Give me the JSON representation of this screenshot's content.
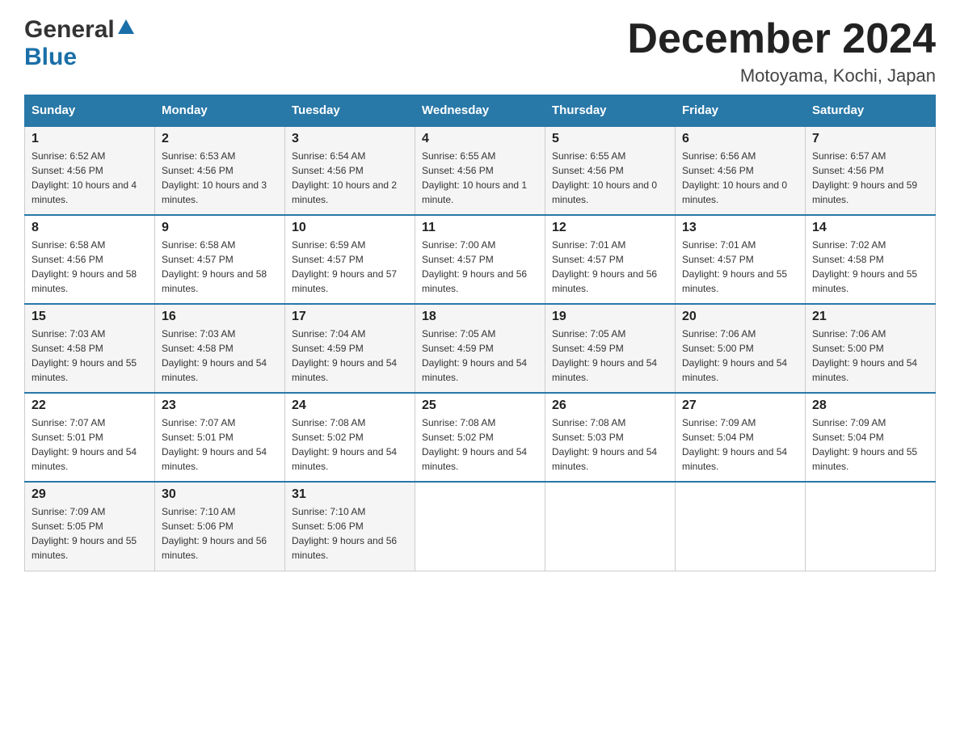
{
  "logo": {
    "general": "General",
    "blue": "Blue"
  },
  "title": {
    "month_year": "December 2024",
    "location": "Motoyama, Kochi, Japan"
  },
  "days_of_week": [
    "Sunday",
    "Monday",
    "Tuesday",
    "Wednesday",
    "Thursday",
    "Friday",
    "Saturday"
  ],
  "weeks": [
    [
      {
        "day": "1",
        "sunrise": "6:52 AM",
        "sunset": "4:56 PM",
        "daylight": "10 hours and 4 minutes."
      },
      {
        "day": "2",
        "sunrise": "6:53 AM",
        "sunset": "4:56 PM",
        "daylight": "10 hours and 3 minutes."
      },
      {
        "day": "3",
        "sunrise": "6:54 AM",
        "sunset": "4:56 PM",
        "daylight": "10 hours and 2 minutes."
      },
      {
        "day": "4",
        "sunrise": "6:55 AM",
        "sunset": "4:56 PM",
        "daylight": "10 hours and 1 minute."
      },
      {
        "day": "5",
        "sunrise": "6:55 AM",
        "sunset": "4:56 PM",
        "daylight": "10 hours and 0 minutes."
      },
      {
        "day": "6",
        "sunrise": "6:56 AM",
        "sunset": "4:56 PM",
        "daylight": "10 hours and 0 minutes."
      },
      {
        "day": "7",
        "sunrise": "6:57 AM",
        "sunset": "4:56 PM",
        "daylight": "9 hours and 59 minutes."
      }
    ],
    [
      {
        "day": "8",
        "sunrise": "6:58 AM",
        "sunset": "4:56 PM",
        "daylight": "9 hours and 58 minutes."
      },
      {
        "day": "9",
        "sunrise": "6:58 AM",
        "sunset": "4:57 PM",
        "daylight": "9 hours and 58 minutes."
      },
      {
        "day": "10",
        "sunrise": "6:59 AM",
        "sunset": "4:57 PM",
        "daylight": "9 hours and 57 minutes."
      },
      {
        "day": "11",
        "sunrise": "7:00 AM",
        "sunset": "4:57 PM",
        "daylight": "9 hours and 56 minutes."
      },
      {
        "day": "12",
        "sunrise": "7:01 AM",
        "sunset": "4:57 PM",
        "daylight": "9 hours and 56 minutes."
      },
      {
        "day": "13",
        "sunrise": "7:01 AM",
        "sunset": "4:57 PM",
        "daylight": "9 hours and 55 minutes."
      },
      {
        "day": "14",
        "sunrise": "7:02 AM",
        "sunset": "4:58 PM",
        "daylight": "9 hours and 55 minutes."
      }
    ],
    [
      {
        "day": "15",
        "sunrise": "7:03 AM",
        "sunset": "4:58 PM",
        "daylight": "9 hours and 55 minutes."
      },
      {
        "day": "16",
        "sunrise": "7:03 AM",
        "sunset": "4:58 PM",
        "daylight": "9 hours and 54 minutes."
      },
      {
        "day": "17",
        "sunrise": "7:04 AM",
        "sunset": "4:59 PM",
        "daylight": "9 hours and 54 minutes."
      },
      {
        "day": "18",
        "sunrise": "7:05 AM",
        "sunset": "4:59 PM",
        "daylight": "9 hours and 54 minutes."
      },
      {
        "day": "19",
        "sunrise": "7:05 AM",
        "sunset": "4:59 PM",
        "daylight": "9 hours and 54 minutes."
      },
      {
        "day": "20",
        "sunrise": "7:06 AM",
        "sunset": "5:00 PM",
        "daylight": "9 hours and 54 minutes."
      },
      {
        "day": "21",
        "sunrise": "7:06 AM",
        "sunset": "5:00 PM",
        "daylight": "9 hours and 54 minutes."
      }
    ],
    [
      {
        "day": "22",
        "sunrise": "7:07 AM",
        "sunset": "5:01 PM",
        "daylight": "9 hours and 54 minutes."
      },
      {
        "day": "23",
        "sunrise": "7:07 AM",
        "sunset": "5:01 PM",
        "daylight": "9 hours and 54 minutes."
      },
      {
        "day": "24",
        "sunrise": "7:08 AM",
        "sunset": "5:02 PM",
        "daylight": "9 hours and 54 minutes."
      },
      {
        "day": "25",
        "sunrise": "7:08 AM",
        "sunset": "5:02 PM",
        "daylight": "9 hours and 54 minutes."
      },
      {
        "day": "26",
        "sunrise": "7:08 AM",
        "sunset": "5:03 PM",
        "daylight": "9 hours and 54 minutes."
      },
      {
        "day": "27",
        "sunrise": "7:09 AM",
        "sunset": "5:04 PM",
        "daylight": "9 hours and 54 minutes."
      },
      {
        "day": "28",
        "sunrise": "7:09 AM",
        "sunset": "5:04 PM",
        "daylight": "9 hours and 55 minutes."
      }
    ],
    [
      {
        "day": "29",
        "sunrise": "7:09 AM",
        "sunset": "5:05 PM",
        "daylight": "9 hours and 55 minutes."
      },
      {
        "day": "30",
        "sunrise": "7:10 AM",
        "sunset": "5:06 PM",
        "daylight": "9 hours and 56 minutes."
      },
      {
        "day": "31",
        "sunrise": "7:10 AM",
        "sunset": "5:06 PM",
        "daylight": "9 hours and 56 minutes."
      },
      null,
      null,
      null,
      null
    ]
  ],
  "labels": {
    "sunrise": "Sunrise:",
    "sunset": "Sunset:",
    "daylight": "Daylight:"
  }
}
